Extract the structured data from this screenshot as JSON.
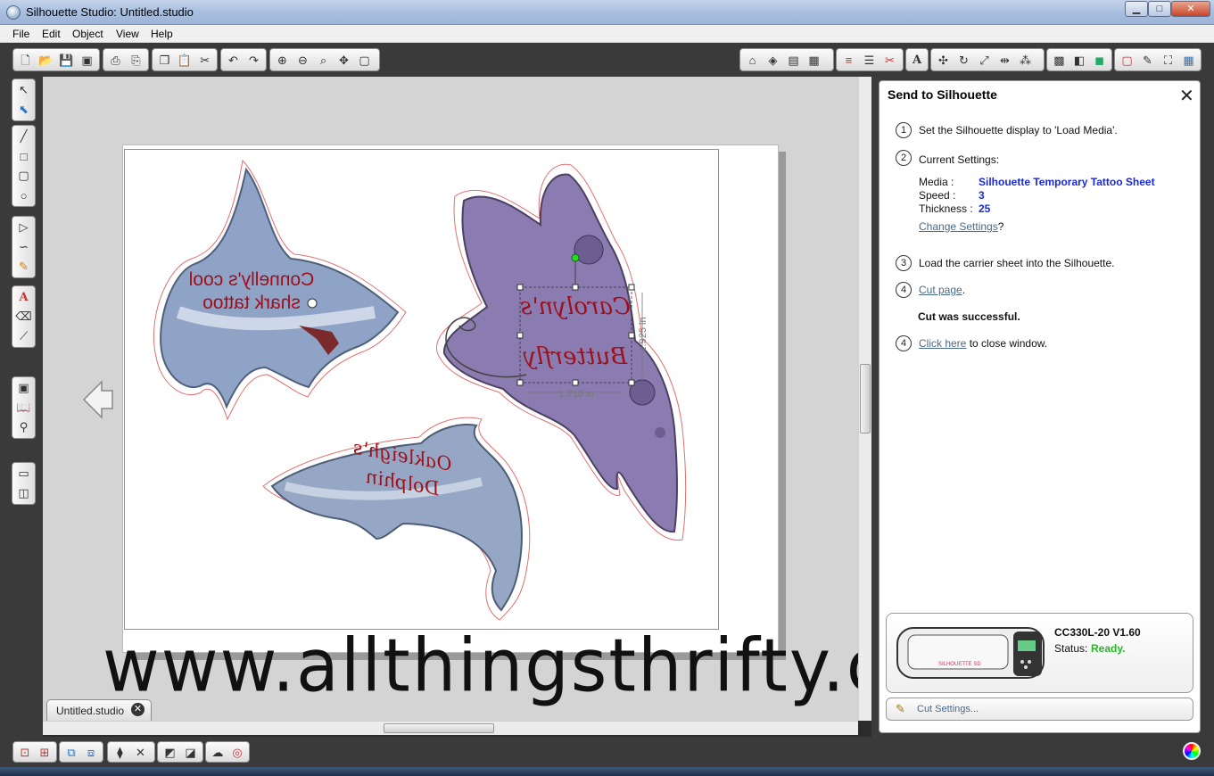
{
  "window": {
    "title": "Silhouette Studio: Untitled.studio",
    "min": "▁",
    "max": "□",
    "close": "✕"
  },
  "menu": [
    "File",
    "Edit",
    "Object",
    "View",
    "Help"
  ],
  "document_tab": {
    "label": "Untitled.studio",
    "close": "✕"
  },
  "canvas": {
    "shark_text": [
      "Connelly's cool",
      "shark tattoo"
    ],
    "butterfly_text": [
      "Carolyn's",
      "Butterfly"
    ],
    "dolphin_text": [
      "Oakleigh's",
      "Dolphin"
    ],
    "width_dim": "1.710 in",
    "height_dim": "1.925 in",
    "watermark": "www.allthingsthrifty.com"
  },
  "panel": {
    "title": "Send to Silhouette",
    "steps": {
      "s1": {
        "num": "1",
        "text": "Set the Silhouette display to 'Load Media'."
      },
      "s2": {
        "num": "2",
        "text": "Current Settings:"
      },
      "s3": {
        "num": "3",
        "text": "Load the carrier sheet into the Silhouette."
      },
      "s4": {
        "num": "4",
        "link": "Cut page",
        "after": "."
      },
      "s5": {
        "num": "4",
        "link": "Click here",
        "after": " to close window."
      }
    },
    "settings": {
      "media_label": "Media :",
      "media_value": "Silhouette Temporary Tattoo Sheet",
      "speed_label": "Speed :",
      "speed_value": "3",
      "thickness_label": "Thickness :",
      "thickness_value": "25"
    },
    "change_settings": "Change Settings",
    "change_settings_q": "?",
    "cut_status": "Cut was successful.",
    "device": {
      "model": "CC330L-20 V1.60",
      "status_label": "Status:",
      "status_value": "Ready.",
      "brand": "SILHOUETTE SD"
    },
    "cut_settings": "Cut Settings..."
  },
  "colors": {
    "status_ready": "#22bb22",
    "setting_value": "#1a2adb",
    "cut_line": "#e07070",
    "tattoo_text": "#a0101a"
  }
}
